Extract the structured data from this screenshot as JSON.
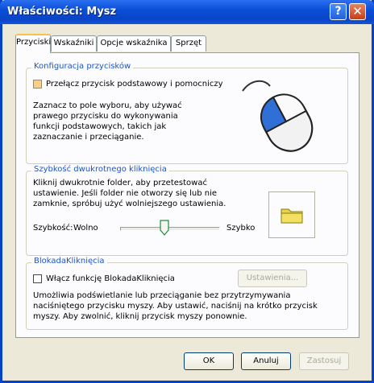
{
  "window": {
    "title": "Właściwości: Mysz"
  },
  "title_buttons": {
    "help": "?",
    "close": "✕"
  },
  "tabs": [
    {
      "label": "Przyciski",
      "active": true
    },
    {
      "label": "Wskaźniki",
      "active": false
    },
    {
      "label": "Opcje wskaźnika",
      "active": false
    },
    {
      "label": "Sprzęt",
      "active": false
    }
  ],
  "button_config": {
    "legend": "Konfiguracja przycisków",
    "checkbox_label": "Przełącz przycisk podstawowy i pomocniczy",
    "checked": false,
    "description": "Zaznacz to pole wyboru, aby używać prawego przycisku do wykonywania funkcji podstawowych, takich jak zaznaczanie i przeciąganie."
  },
  "double_click": {
    "legend": "Szybkość dwukrotnego kliknięcia",
    "description": "Kliknij dwukrotnie folder, aby przetestować ustawienie. Jeśli folder nie otworzy się lub nie zamknie, spróbuj użyć wolniejszego ustawienia.",
    "speed_label": "Szybkość:",
    "slow_label": "Wolno",
    "fast_label": "Szybko",
    "speed_value": 0.45
  },
  "click_lock": {
    "legend": "BlokadaKliknięcia",
    "checkbox_label": "Włącz funkcję BlokadaKliknięcia",
    "checked": false,
    "settings_button": "Ustawienia...",
    "description": "Umożliwia podświetlanie lub przeciąganie bez przytrzymywania naciśniętego przycisku myszy. Aby ustawić, naciśnij na krótko przycisk myszy. Aby zwolnić, kliknij przycisk myszy ponownie."
  },
  "footer": {
    "ok": "OK",
    "cancel": "Anuluj",
    "apply": "Zastosuj"
  },
  "colors": {
    "title_bar": "#0a44c7",
    "group_legend": "#1e55c8",
    "mouse_button": "#2f6fd6",
    "folder": "#e8d44a"
  },
  "icons": [
    "mouse-illustration",
    "folder-icon",
    "slider-thumb"
  ]
}
